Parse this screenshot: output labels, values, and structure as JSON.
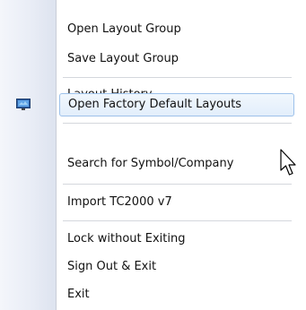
{
  "menu": {
    "items": [
      {
        "label": "Open Layout Group"
      },
      {
        "label": "Save Layout Group"
      },
      {
        "label": "Layout History"
      },
      {
        "label": "Open Factory Default Layouts"
      },
      {
        "label": "Search for Symbol/Company"
      },
      {
        "label": "Import TC2000 v7"
      },
      {
        "label": "Lock without Exiting"
      },
      {
        "label": "Sign Out & Exit"
      },
      {
        "label": "Exit"
      }
    ],
    "highlighted_item": "Open Factory Default Layouts"
  },
  "icons": {
    "factory_default_layouts": "monitor-icon",
    "pointer": "mouse-cursor-icon"
  },
  "colors": {
    "highlight_border": "#9dc1ea",
    "highlight_fill": "#e2eefb",
    "gutter": "#e9edf6",
    "separator": "#d4d7dd",
    "text": "#111111"
  }
}
